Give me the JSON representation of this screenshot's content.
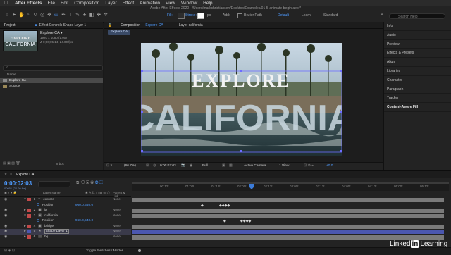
{
  "menubar": {
    "apple": "",
    "app": "After Effects",
    "items": [
      "File",
      "Edit",
      "Composition",
      "Layer",
      "Effect",
      "Animation",
      "View",
      "Window",
      "Help"
    ]
  },
  "toolbar": {
    "title": "Adobe After Effects 2020 - /Users/markchristiansen/Desktop/Examples/01-5-animate-begin.aep *",
    "fill_label": "Fill:",
    "stroke_label": "Stroke:",
    "stroke_width": "px",
    "add_label": "Add:",
    "bezier_label": "Bezier Path",
    "workspaces": [
      "Default",
      "Learn",
      "Standard"
    ],
    "search_placeholder": "Search Help"
  },
  "project": {
    "tab": "Project",
    "tab2": "Effect Controls Shape Layer 1",
    "comp_name": "Explore CA ▾",
    "comp_size": "1920 x 1080 (1.00)",
    "comp_dur": "Δ 0;00;05;14, 24.00 fps",
    "bpc": "8 bpc",
    "search_ph": "",
    "col_name": "Name",
    "items": [
      {
        "name": "Explore CA"
      },
      {
        "name": "Source"
      }
    ]
  },
  "comp": {
    "tab": "Composition Explore CA",
    "tab2": "Layer california",
    "breadcrumb": "Explore CA",
    "title_top": "EXPLORE",
    "title_big": "CALIFORNIA",
    "zoom": "(66.7%)",
    "timecode": "0:00:02:03",
    "quality": "Full",
    "camera": "Active Camera",
    "views": "1 View",
    "offset": "+0.0"
  },
  "right_panel": {
    "items": [
      {
        "label": "Info"
      },
      {
        "label": "Audio"
      },
      {
        "label": "Preview"
      },
      {
        "label": "Effects & Presets"
      },
      {
        "label": "Align"
      },
      {
        "label": "Libraries"
      },
      {
        "label": "Character"
      },
      {
        "label": "Paragraph"
      },
      {
        "label": "Tracker"
      },
      {
        "label": "Content-Aware Fill"
      }
    ]
  },
  "timeline": {
    "tab": "Explore CA",
    "timecode": "0:00:02:03",
    "fps_sub": "00051 (24.00 fps)",
    "col_layer": "Layer Name",
    "col_parent": "Parent & Link",
    "ticks": [
      "00:12f",
      "01:00f",
      "01:12f",
      "02:00f",
      "02:12f",
      "03:00f",
      "03:12f",
      "04:00f",
      "04:12f",
      "05:00f",
      "05:12f"
    ],
    "layers": [
      {
        "num": "1",
        "name": "explore",
        "parent": "None",
        "kind": "layer"
      },
      {
        "num": "",
        "name": "Position",
        "value": "960.0,540.0",
        "kind": "prop"
      },
      {
        "num": "2",
        "name": "la",
        "parent": "None",
        "kind": "layer"
      },
      {
        "num": "3",
        "name": "california",
        "parent": "None",
        "kind": "layer"
      },
      {
        "num": "",
        "name": "Position",
        "value": "960.0,540.0",
        "kind": "prop"
      },
      {
        "num": "4",
        "name": "bridge",
        "parent": "None",
        "kind": "layer"
      },
      {
        "num": "5",
        "name": "Shape Layer 1",
        "parent": "None",
        "kind": "layer"
      },
      {
        "num": "6",
        "name": "bg",
        "parent": "None",
        "kind": "layer"
      }
    ],
    "toggle_label": "Toggle Switches / Modes"
  },
  "watermark": {
    "brand1": "Linked",
    "brand2": "in",
    "brand3": "Learning"
  },
  "colors": {
    "accent": "#2d8ceb",
    "track_gray": "#7a7a7a",
    "track_blue": "#4b57b0",
    "playhead": "#3b7bd8"
  }
}
